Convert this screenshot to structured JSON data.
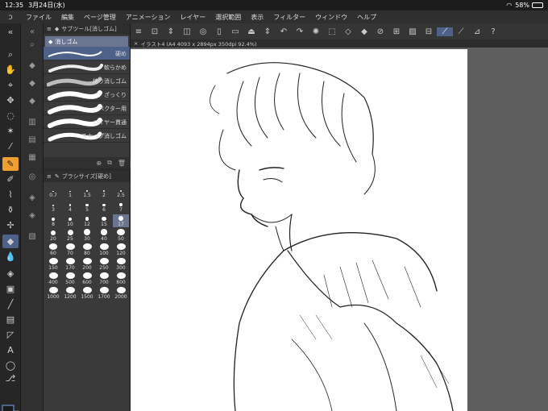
{
  "status": {
    "time": "12:35",
    "date": "3月24日(水)",
    "wifi": "wifi-icon",
    "battery": "58%"
  },
  "menu": [
    "ファイル",
    "編集",
    "ページ管理",
    "アニメーション",
    "レイヤー",
    "選択範囲",
    "表示",
    "フィルター",
    "ウィンドウ",
    "ヘルプ"
  ],
  "subtool": {
    "header": "サブツール[消しゴム]",
    "group": "消しゴム",
    "brushes": [
      {
        "label": "硬め"
      },
      {
        "label": "軟らかめ"
      },
      {
        "label": "練り消しゴム"
      },
      {
        "label": "ざっくり"
      },
      {
        "label": "ベクター用"
      },
      {
        "label": "レイヤー貫通"
      },
      {
        "label": "スナップ消しゴム"
      }
    ]
  },
  "brushsize": {
    "header": "ブラシサイズ[硬め]",
    "sizes": [
      "0.7",
      "1",
      "1.5",
      "2",
      "2.5",
      "3",
      "4",
      "5",
      "6",
      "7",
      "8",
      "10",
      "12",
      "15",
      "17",
      "20",
      "25",
      "30",
      "40",
      "50",
      "60",
      "70",
      "80",
      "100",
      "120",
      "150",
      "170",
      "200",
      "250",
      "300",
      "400",
      "500",
      "600",
      "700",
      "800",
      "1000",
      "1200",
      "1500",
      "1700",
      "2000"
    ],
    "selected": "17"
  },
  "document": {
    "tab": "イラスト4 (A4 4093 x 2894px 350dpi 92.4%)"
  },
  "colors": {
    "accent": "#f0a030",
    "selection": "#4e6189",
    "main_color": "#1a1a1a",
    "sub_color": "#ffffff"
  }
}
